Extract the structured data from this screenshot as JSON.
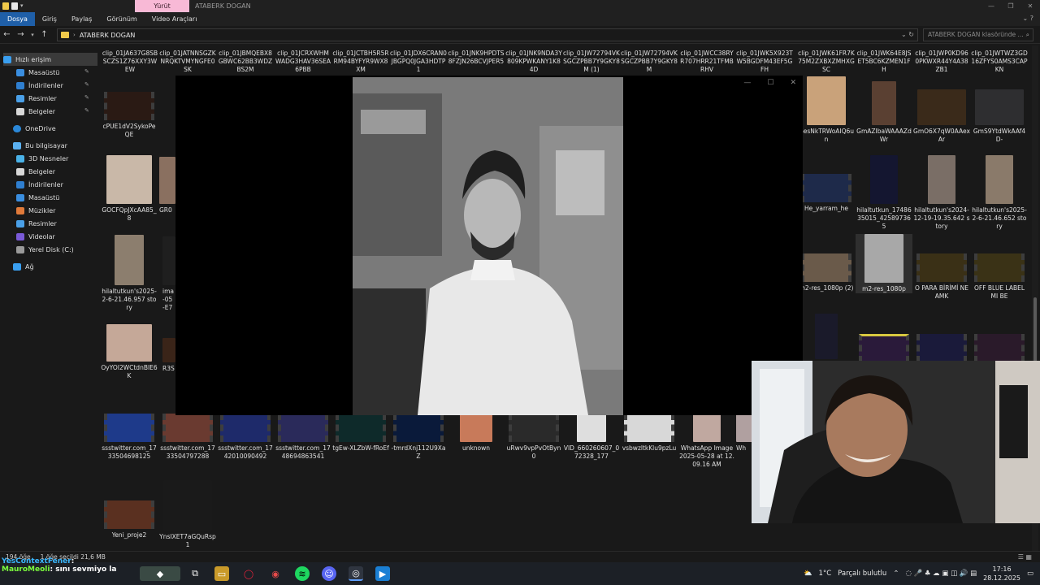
{
  "window": {
    "context_tab": "Yürüt",
    "title": "ATABERK DOGAN"
  },
  "ribbon": {
    "tabs": [
      "Dosya",
      "Giriş",
      "Paylaş",
      "Görünüm",
      "Video Araçları"
    ]
  },
  "address": {
    "path": "ATABERK DOGAN",
    "search_placeholder": "ATABERK DOGAN klasöründe ..."
  },
  "sidebar": {
    "items": [
      {
        "label": "Hızlı erişim",
        "icon": "star-icon",
        "pinned": false
      },
      {
        "label": "Masaüstü",
        "icon": "desktop-icon",
        "pinned": true
      },
      {
        "label": "İndirilenler",
        "icon": "download-icon",
        "pinned": true
      },
      {
        "label": "Resimler",
        "icon": "pictures-icon",
        "pinned": true
      },
      {
        "label": "Belgeler",
        "icon": "documents-icon",
        "pinned": true
      },
      {
        "label": "OneDrive",
        "icon": "cloud-icon",
        "pinned": false
      },
      {
        "label": "Bu bilgisayar",
        "icon": "computer-icon",
        "pinned": false
      },
      {
        "label": "3D Nesneler",
        "icon": "cube-icon",
        "pinned": false
      },
      {
        "label": "Belgeler",
        "icon": "documents-icon",
        "pinned": false
      },
      {
        "label": "İndirilenler",
        "icon": "download-icon",
        "pinned": false
      },
      {
        "label": "Masaüstü",
        "icon": "desktop-icon",
        "pinned": false
      },
      {
        "label": "Müzikler",
        "icon": "music-icon",
        "pinned": false
      },
      {
        "label": "Resimler",
        "icon": "pictures-icon",
        "pinned": false
      },
      {
        "label": "Videolar",
        "icon": "video-icon",
        "pinned": false
      },
      {
        "label": "Yerel Disk (C:)",
        "icon": "disk-icon",
        "pinned": false
      },
      {
        "label": "Ağ",
        "icon": "network-icon",
        "pinned": false
      }
    ]
  },
  "files": {
    "top_row": [
      "clip_01JA637G8SBSCZS1Z76XXY3WEW",
      "clip_01JATNNSGZKNRQKTVMYNGFE0SK",
      "clip_01JBMQEBX8GBWC62BB3WDZBS2M",
      "clip_01JCRXWHMWADG3HAV36SEA6PBB",
      "clip_01JCTBH5R5RRM94BYFYR9WX8XM",
      "clip_01JDX6CRAN0JBGPQ0JGA3HDTP1",
      "clip_01JNK9HPDTS8FZJN26BCVJPER5",
      "clip_01JNK9NDA3Y809KPWKANY1K84D",
      "clip_01JW72794VKSGCZPBB7Y9GKY8M (1)",
      "clip_01JW72794VKSGCZPBB7Y9GKY8M",
      "clip_01JWCC38RYR707HRR21TFMBRHV",
      "clip_01JWK5X923TW5BGDFM43EF5GFH",
      "clip_01JWK61FR7K75M2ZXBXZMHXGSC",
      "clip_01JWK64E8JSET5BC6KZMEN1FH",
      "clip_01JWP0KD960PKWXR44Y4A38ZB1",
      "clip_01JWTWZ3GD16ZFYS0AMS3CAPKN"
    ],
    "left_col": [
      "cPUE1dV2SykoPeQE",
      "GOCFQpJXcAA85_8",
      "hilaltutkun's2025-2-6-21.46.957 story",
      "OyYOI2WCtdnBIE6K",
      "Yeni_proje2"
    ],
    "partial_col": [
      "GR0",
      "ima -05 -E7",
      "R3S"
    ],
    "right_block": [
      "GesNkTRWoAIQ6un",
      "GmAZIbaWAAAZdWr",
      "GmO6X7qW0AAexAr",
      "GmS9YtdWkAAf4D-",
      "He_yarram_he",
      "hilaltutkun_1748635015_425897365",
      "hilaltutkun's2024-12-19-19.35.642 story",
      "hilaltutkun's2025-2-6-21.46.652 story",
      "m2-res_1080p (2)",
      "m2-res_1080p",
      "O PARA BİRİMİ NE AMK",
      "OFF BLUE LABEL MI BE"
    ],
    "bottom_row": [
      "ssstwitter.com_1733504698125",
      "ssstwitter.com_1733504797288",
      "ssstwitter.com_1742010090492",
      "ssstwitter.com_1748694863541",
      "tgEw-XLZbW-fRoEf",
      "-tmrdXnj112U9XaZ",
      "unknown",
      "uRwv9vpPvOtByn0",
      "VID_660260607_072328_177",
      "vsbwzltkKlu9pzLu",
      "WhatsApp Image 2025-05-28 at 12.09.16 AM",
      "Wh"
    ],
    "last_row_extra": "YnsIXET7aGQuRsp1"
  },
  "status": {
    "item_count": "194 öğe",
    "selected": "1 öğe seçildi  21,6 MB"
  },
  "chat": {
    "user1": "YesContextFener",
    "user1_text": ":",
    "user2": "MauroMeoli",
    "message": ": sını sevmiyo la"
  },
  "tray": {
    "temperature": "1°C",
    "weather": "Parçalı bulutlu",
    "time": "17:16",
    "date": "28.12.2025"
  }
}
